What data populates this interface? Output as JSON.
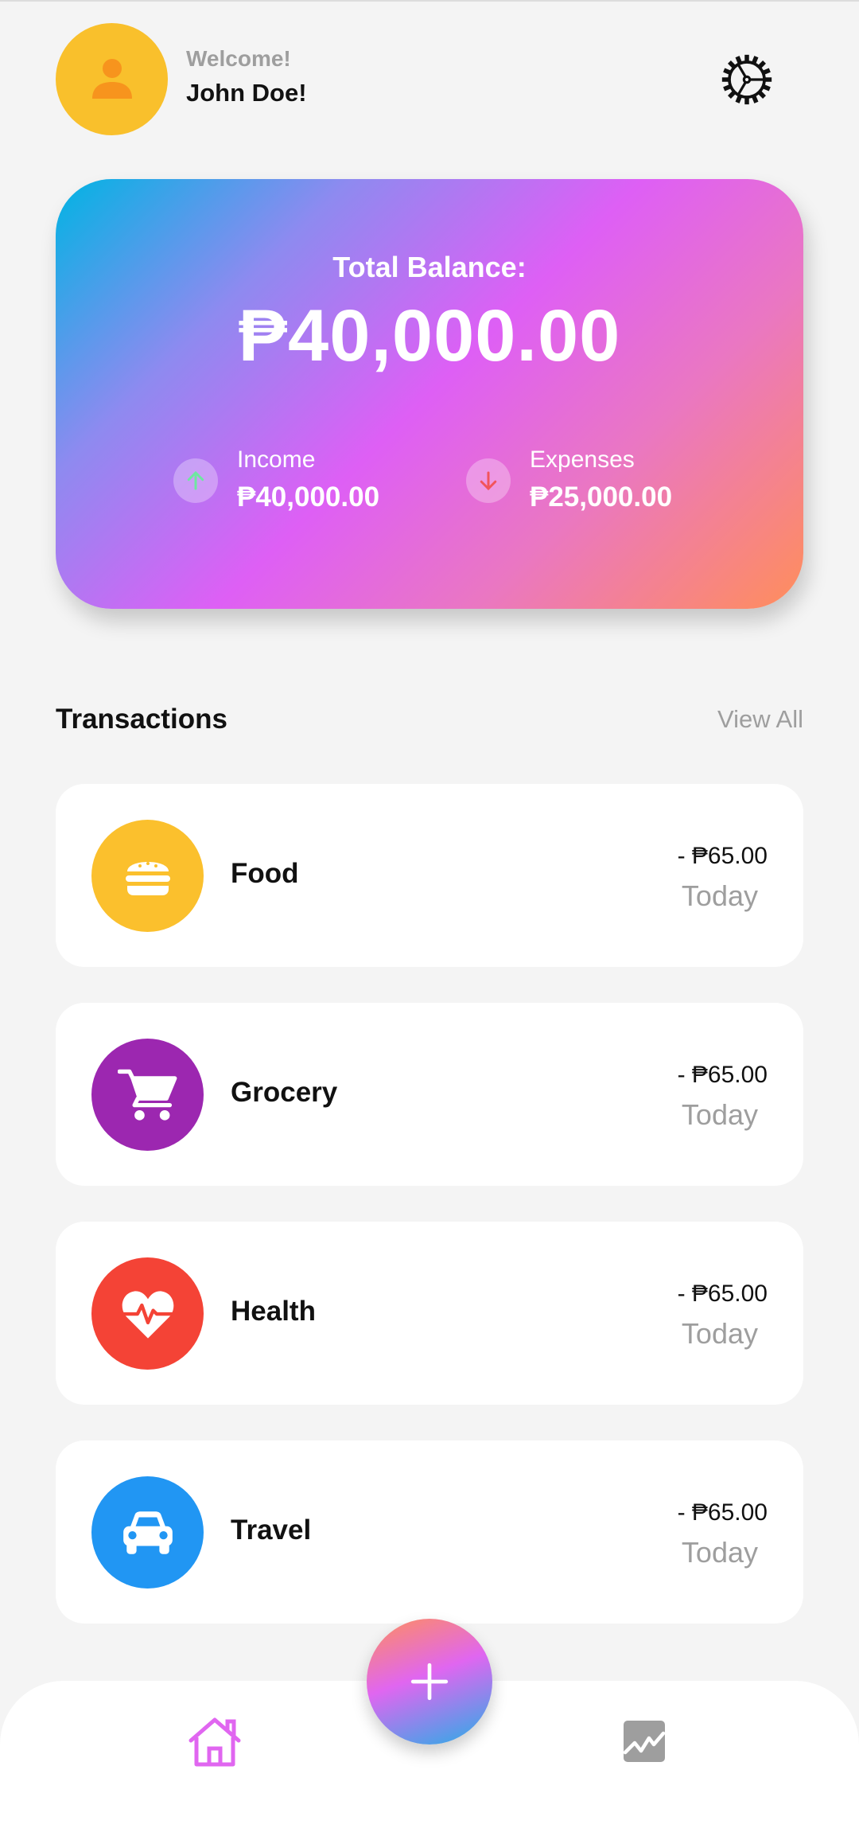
{
  "header": {
    "welcome": "Welcome!",
    "username": "John Doe!",
    "avatar_icon": "person-icon",
    "settings_icon": "gear-icon"
  },
  "balance_card": {
    "label": "Total Balance:",
    "amount": "₱40,000.00",
    "income": {
      "label": "Income",
      "value": "₱40,000.00",
      "icon": "arrow-up-icon"
    },
    "expenses": {
      "label": "Expenses",
      "value": "₱25,000.00",
      "icon": "arrow-down-icon"
    }
  },
  "transactions": {
    "title": "Transactions",
    "view_all": "View All",
    "items": [
      {
        "name": "Food",
        "amount": "- ₱65.00",
        "date": "Today",
        "icon": "burger-icon",
        "color": "#fbc02d"
      },
      {
        "name": "Grocery",
        "amount": "- ₱65.00",
        "date": "Today",
        "icon": "cart-icon",
        "color": "#9c27b0"
      },
      {
        "name": "Health",
        "amount": "- ₱65.00",
        "date": "Today",
        "icon": "heart-pulse-icon",
        "color": "#f44336"
      },
      {
        "name": "Travel",
        "amount": "- ₱65.00",
        "date": "Today",
        "icon": "car-icon",
        "color": "#2196f3"
      }
    ]
  },
  "bottom_nav": {
    "home_icon": "home-icon",
    "add_icon": "plus-icon",
    "stats_icon": "chart-icon"
  },
  "colors": {
    "accent_pink": "#e066f0",
    "income_arrow": "#6ee7a0",
    "expense_arrow": "#f2545b"
  }
}
